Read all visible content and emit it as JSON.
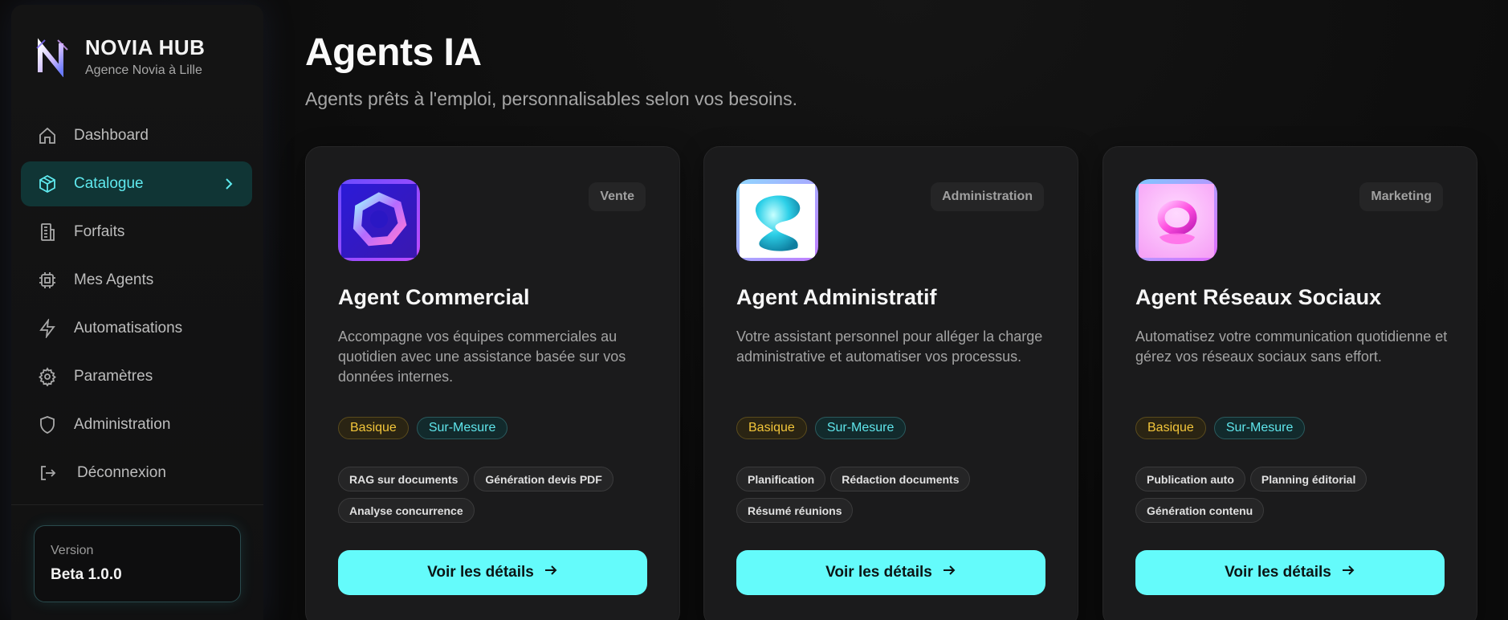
{
  "brand": {
    "title": "NOVIA HUB",
    "subtitle": "Agence Novia à Lille"
  },
  "sidebar": {
    "items": [
      {
        "label": "Dashboard",
        "icon": "home-icon"
      },
      {
        "label": "Catalogue",
        "icon": "cube-icon",
        "active": true
      },
      {
        "label": "Forfaits",
        "icon": "building-icon"
      },
      {
        "label": "Mes Agents",
        "icon": "chip-icon"
      },
      {
        "label": "Automatisations",
        "icon": "bolt-icon"
      },
      {
        "label": "Paramètres",
        "icon": "gear-icon"
      },
      {
        "label": "Administration",
        "icon": "shield-icon"
      }
    ],
    "logout": {
      "label": "Déconnexion",
      "icon": "logout-icon"
    },
    "version": {
      "label": "Version",
      "value": "Beta 1.0.0"
    }
  },
  "page": {
    "title": "Agents IA",
    "subtitle": "Agents prêts à l'emploi, personnalisables selon vos besoins."
  },
  "cards": [
    {
      "category": "Vente",
      "title": "Agent Commercial",
      "description": "Accompagne vos équipes commerciales au quotidien avec une assistance basée sur vos données internes.",
      "tiers": [
        "Basique",
        "Sur-Mesure"
      ],
      "features": [
        "RAG sur documents",
        "Génération devis PDF",
        "Analyse concurrence"
      ],
      "cta": "Voir les détails",
      "icon": "agent-commercial-icon"
    },
    {
      "category": "Administration",
      "title": "Agent Administratif",
      "description": "Votre assistant personnel pour alléger la charge administrative et automatiser vos processus.",
      "tiers": [
        "Basique",
        "Sur-Mesure"
      ],
      "features": [
        "Planification",
        "Rédaction documents",
        "Résumé réunions"
      ],
      "cta": "Voir les détails",
      "icon": "agent-administratif-icon"
    },
    {
      "category": "Marketing",
      "title": "Agent Réseaux Sociaux",
      "description": "Automatisez votre communication quotidienne et gérez vos réseaux sociaux sans effort.",
      "tiers": [
        "Basique",
        "Sur-Mesure"
      ],
      "features": [
        "Publication auto",
        "Planning éditorial",
        "Génération contenu"
      ],
      "cta": "Voir les détails",
      "icon": "agent-reseaux-sociaux-icon"
    }
  ],
  "colors": {
    "accent": "#64fbfb",
    "active_bg": "#103535",
    "basic": "#f2c53a",
    "custom": "#5fe6ec"
  }
}
